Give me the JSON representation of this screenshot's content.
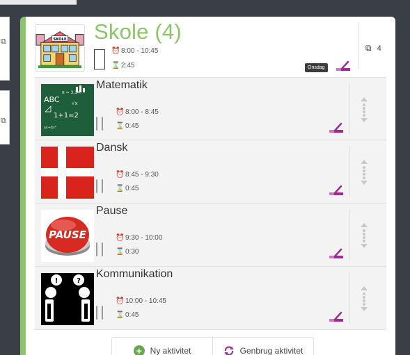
{
  "background": {
    "card_icon": "⧉"
  },
  "header": {
    "title": "Skole (4)",
    "time_range": "8:00 - 10:45",
    "duration": "2:45",
    "day_badge": "Onsdag",
    "count": "4",
    "image_label": "SKOLE",
    "alarm_icon": "⏰",
    "hourglass_icon": "⌛",
    "group_icon": "⧉"
  },
  "activities": [
    {
      "title": "Matematik",
      "time_range": "8:00 - 8:45",
      "duration": "0:45",
      "board_text": [
        "ABC",
        "π = 3,14",
        "1+1=2",
        "√x",
        "(a+b)²"
      ]
    },
    {
      "title": "Dansk",
      "time_range": "8:45 - 9:30",
      "duration": "0:45"
    },
    {
      "title": "Pause",
      "time_range": "9:30 - 10:00",
      "duration": "0:30",
      "button_text": "PAUSE"
    },
    {
      "title": "Kommunikation",
      "time_range": "10:00 - 10:45",
      "duration": "0:45"
    }
  ],
  "buttons": {
    "new_activity": "Ny aktivitet",
    "reuse_activity": "Genbrug aktivitet"
  },
  "colors": {
    "accent_green": "#8cc46b",
    "edit_purple": "#9c2e8e",
    "badge_dark": "#3c3c3c",
    "flag_red": "#d9241d"
  }
}
